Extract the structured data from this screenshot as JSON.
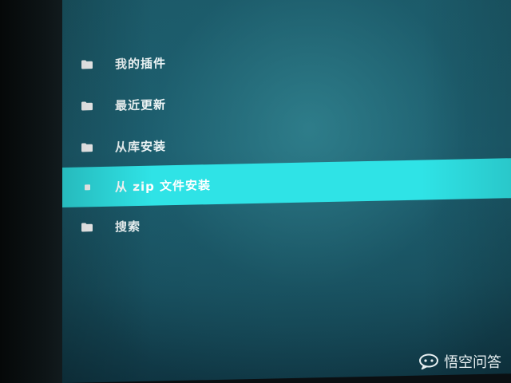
{
  "menu": {
    "items": [
      {
        "label": "我的插件",
        "icon": "folder-icon",
        "selected": false
      },
      {
        "label": "最近更新",
        "icon": "folder-icon",
        "selected": false
      },
      {
        "label": "从库安装",
        "icon": "folder-icon",
        "selected": false
      },
      {
        "label": "从 zip 文件安装",
        "icon": "square-bullet-icon",
        "selected": true
      },
      {
        "label": "搜索",
        "icon": "folder-icon",
        "selected": false
      }
    ]
  },
  "watermark": {
    "text": "悟空问答",
    "icon": "speech-bubble-logo-icon"
  },
  "colors": {
    "highlight": "#2fe3e6",
    "background": "#1b5968",
    "text": "#eef6f7"
  }
}
